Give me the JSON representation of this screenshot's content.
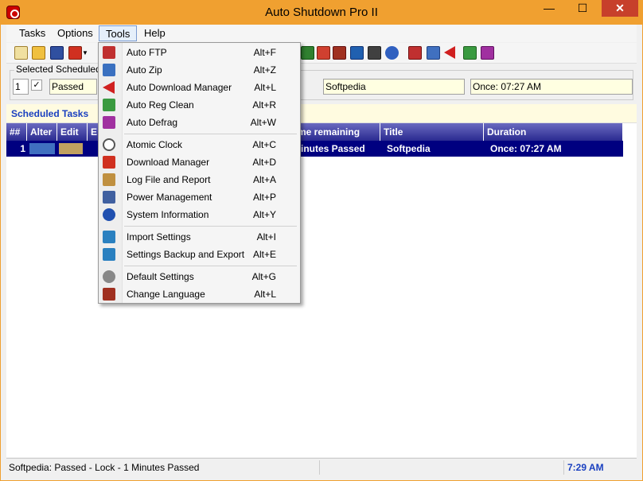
{
  "window": {
    "title": "Auto Shutdown Pro II",
    "min": "—",
    "max": "☐",
    "close": "✕"
  },
  "menubar": [
    {
      "label": "Tasks"
    },
    {
      "label": "Options"
    },
    {
      "label": "Tools"
    },
    {
      "label": "Help"
    }
  ],
  "scheduled": {
    "legend": "Selected Scheduled Task",
    "num": "1",
    "status": "Passed",
    "title": "Softpedia",
    "duration": "Once: 07:27 AM"
  },
  "tasks_header": "Scheduled Tasks",
  "grid": {
    "headers": [
      "##",
      "Alter",
      "Edit",
      "E",
      "me remaining",
      "Title",
      "Duration"
    ],
    "row": {
      "num": "1",
      "remaining": "inutes Passed",
      "title": "Softpedia",
      "duration": "Once: 07:27 AM"
    }
  },
  "tools_menu": [
    {
      "label": "Auto FTP",
      "shortcut": "Alt+F",
      "icon": "ftp-icon",
      "color": "#c03030"
    },
    {
      "label": "Auto Zip",
      "shortcut": "Alt+Z",
      "icon": "zip-icon",
      "color": "#3a70c0"
    },
    {
      "label": "Auto Download Manager",
      "shortcut": "Alt+L",
      "icon": "download-arrow-icon",
      "color": "#d02020"
    },
    {
      "label": "Auto Reg Clean",
      "shortcut": "Alt+R",
      "icon": "reg-clean-icon",
      "color": "#3a9a40"
    },
    {
      "label": "Auto Defrag",
      "shortcut": "Alt+W",
      "icon": "defrag-icon",
      "color": "#a030a0"
    },
    {
      "label": "Atomic Clock",
      "shortcut": "Alt+C",
      "icon": "clock-icon",
      "color": "#555555"
    },
    {
      "label": "Download Manager",
      "shortcut": "Alt+D",
      "icon": "download-icon",
      "color": "#d03020"
    },
    {
      "label": "Log File and Report",
      "shortcut": "Alt+A",
      "icon": "log-icon",
      "color": "#c09040"
    },
    {
      "label": "Power Management",
      "shortcut": "Alt+P",
      "icon": "power-icon",
      "color": "#4060a0"
    },
    {
      "label": "System Information",
      "shortcut": "Alt+Y",
      "icon": "info-icon",
      "color": "#2050b0"
    },
    {
      "label": "Import Settings",
      "shortcut": "Alt+I",
      "icon": "import-icon",
      "color": "#2a80c0"
    },
    {
      "label": "Settings Backup and Export",
      "shortcut": "Alt+E",
      "icon": "export-icon",
      "color": "#2a80c0"
    },
    {
      "label": "Default Settings",
      "shortcut": "Alt+G",
      "icon": "gear-icon",
      "color": "#888888"
    },
    {
      "label": "Change Language",
      "shortcut": "Alt+L",
      "icon": "language-icon",
      "color": "#a03020"
    }
  ],
  "status": {
    "text": "Softpedia:  Passed - Lock - 1 Minutes Passed",
    "time": "7:29 AM"
  }
}
